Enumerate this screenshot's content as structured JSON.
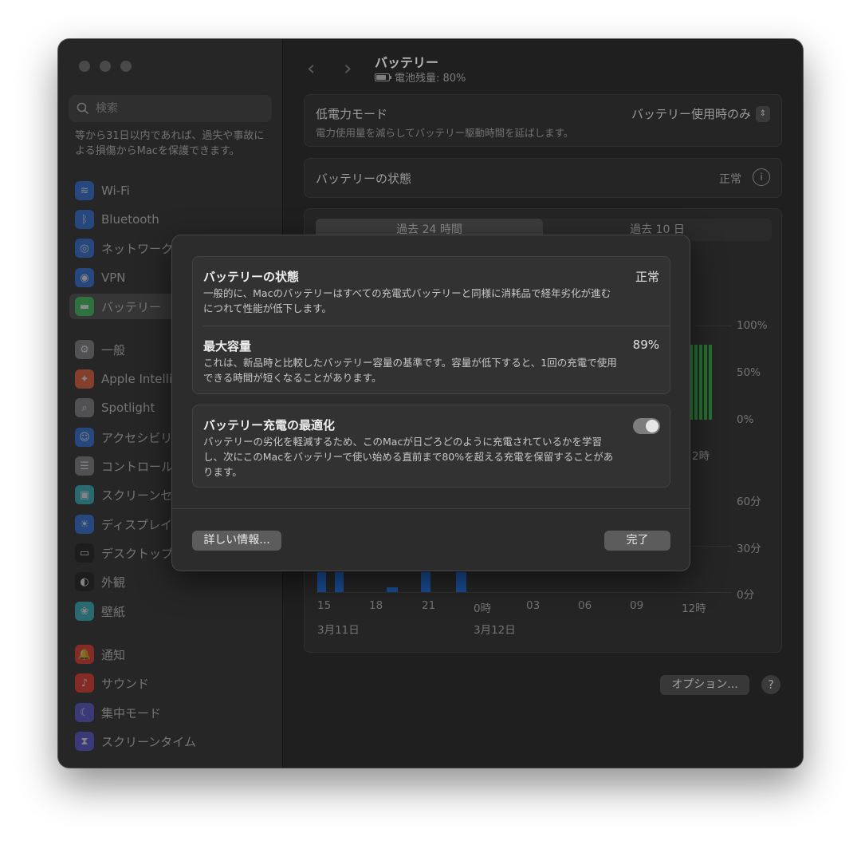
{
  "sidebar": {
    "search_placeholder": "検索",
    "note": "等から31日以内であれば、過失や事故による損傷からMacを保護できます。",
    "items": [
      {
        "label": "Wi-Fi",
        "icon": "wifi-icon",
        "glyph": "≋",
        "color": "#2f7bf6"
      },
      {
        "label": "Bluetooth",
        "icon": "bluetooth-icon",
        "glyph": "ᛒ",
        "color": "#2f7bf6"
      },
      {
        "label": "ネットワーク",
        "icon": "network-icon",
        "glyph": "◎",
        "color": "#2f7bf6"
      },
      {
        "label": "VPN",
        "icon": "vpn-icon",
        "glyph": "◉",
        "color": "#2f7bf6"
      },
      {
        "label": "バッテリー",
        "icon": "battery-icon",
        "glyph": "▬",
        "color": "#34c759"
      },
      {
        "label": "一般",
        "icon": "gear-icon",
        "glyph": "⚙",
        "color": "#8e8e93"
      },
      {
        "label": "Apple Intelligence",
        "icon": "apple-intelligence-icon",
        "glyph": "✦",
        "color": "#ff6a3d"
      },
      {
        "label": "Spotlight",
        "icon": "spotlight-icon",
        "glyph": "⌕",
        "color": "#8e8e93"
      },
      {
        "label": "アクセシビリティ",
        "icon": "accessibility-icon",
        "glyph": "☺",
        "color": "#2f7bf6"
      },
      {
        "label": "コントロールセンター",
        "icon": "control-center-icon",
        "glyph": "☰",
        "color": "#8e8e93"
      },
      {
        "label": "スクリーンセーバ",
        "icon": "screensaver-icon",
        "glyph": "▣",
        "color": "#3ac5d6"
      },
      {
        "label": "ディスプレイ",
        "icon": "display-icon",
        "glyph": "☀",
        "color": "#2f7bf6"
      },
      {
        "label": "デスクトップとDock",
        "icon": "desktop-dock-icon",
        "glyph": "▭",
        "color": "#1c1c1c"
      },
      {
        "label": "外観",
        "icon": "appearance-icon",
        "glyph": "◐",
        "color": "#1c1c1c"
      },
      {
        "label": "壁紙",
        "icon": "wallpaper-icon",
        "glyph": "❀",
        "color": "#3ac5d6"
      },
      {
        "label": "通知",
        "icon": "notification-icon",
        "glyph": "🔔",
        "color": "#ff3b30"
      },
      {
        "label": "サウンド",
        "icon": "sound-icon",
        "glyph": "♪",
        "color": "#ff3b30"
      },
      {
        "label": "集中モード",
        "icon": "focus-icon",
        "glyph": "☾",
        "color": "#5e5ce6"
      },
      {
        "label": "スクリーンタイム",
        "icon": "screen-time-icon",
        "glyph": "⧗",
        "color": "#5e5ce6"
      }
    ]
  },
  "header": {
    "title": "バッテリー",
    "subtitle": "電池残量: 80%"
  },
  "low_power": {
    "title": "低電力モード",
    "desc": "電力使用量を減らしてバッテリー駆動時間を延ばします。",
    "value": "バッテリー使用時のみ"
  },
  "health_row": {
    "title": "バッテリーの状態",
    "value": "正常"
  },
  "usage": {
    "tab_24h": "過去 24 時間",
    "tab_10d": "過去 10 日",
    "level_ticks": [
      "100%",
      "50%",
      "0%"
    ],
    "time_partial": "2時",
    "minute_ticks": [
      "60分",
      "30分",
      "0分"
    ],
    "hour_ticks": [
      "15",
      "18",
      "21",
      "0時",
      "03",
      "06",
      "09",
      "12時"
    ],
    "date_1": "3月11日",
    "date_2": "3月12日"
  },
  "options_button": "オプション...",
  "help_button": "?",
  "modal": {
    "health_title": "バッテリーの状態",
    "health_value": "正常",
    "health_desc": "一般的に、Macのバッテリーはすべての充電式バッテリーと同様に消耗品で経年劣化が進むにつれて性能が低下します。",
    "capacity_title": "最大容量",
    "capacity_value": "89%",
    "capacity_desc": "これは、新品時と比較したバッテリー容量の基準です。容量が低下すると、1回の充電で使用できる時間が短くなることがあります。",
    "optimize_title": "バッテリー充電の最適化",
    "optimize_desc": "バッテリーの劣化を軽減するため、このMacが日ごろどのように充電されているかを学習し、次にこのMacをバッテリーで使い始める直前まで80%を超える充電を保留することがあります。",
    "optimize_on": true,
    "details_button": "詳しい情報...",
    "done_button": "完了"
  }
}
